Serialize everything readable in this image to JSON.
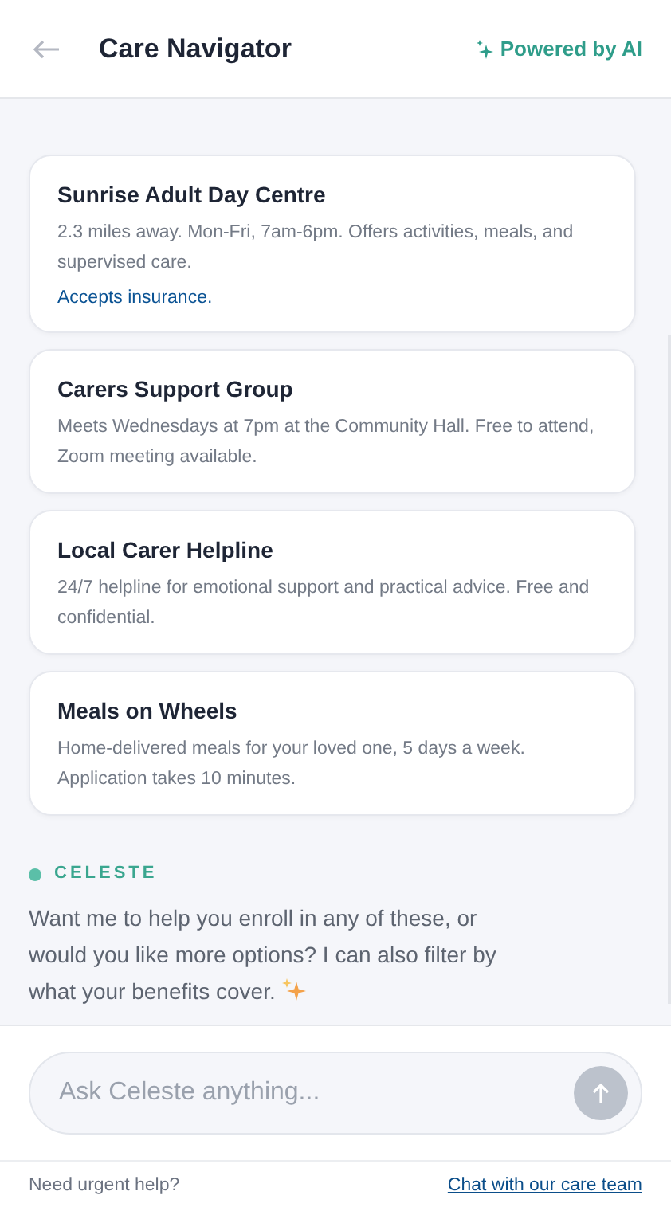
{
  "header": {
    "title": "Care Navigator",
    "badge": "Powered by AI"
  },
  "cards": [
    {
      "title": "Sunrise Adult Day Centre",
      "description": "2.3 miles away. Mon-Fri, 7am-6pm. Offers activities, meals, and supervised care.",
      "note": "Accepts insurance."
    },
    {
      "title": "Carers Support Group",
      "description": "Meets Wednesdays at 7pm at the Community Hall. Free to attend, Zoom meeting available."
    },
    {
      "title": "Local Carer Helpline",
      "description": "24/7 helpline for emotional support and practical advice. Free and confidential."
    },
    {
      "title": "Meals on Wheels",
      "description": "Home-delivered meals for your loved one, 5 days a week. Application takes 10 minutes."
    }
  ],
  "assistant": {
    "name": "CELESTE",
    "message": "Want me to help you enroll in any of these, or would you like more options? I can also filter by what your benefits cover."
  },
  "composer": {
    "placeholder": "Ask Celeste anything...",
    "send_disabled": true
  },
  "footer": {
    "text": "Need urgent help?",
    "link": "Chat with our care team"
  }
}
